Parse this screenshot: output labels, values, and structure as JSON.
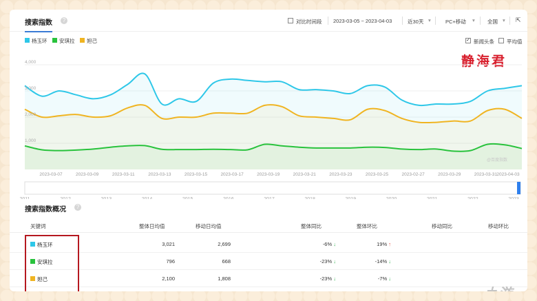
{
  "header": {
    "title": "搜索指数",
    "compare_label": "对比时间段",
    "date_range": "2023-03-05 ~ 2023-04-03",
    "period": "近30天",
    "device": "PC+移动",
    "region": "全国"
  },
  "legend": [
    {
      "name": "杨玉环",
      "color": "#2ec7e8"
    },
    {
      "name": "安琪拉",
      "color": "#28c23c"
    },
    {
      "name": "妲己",
      "color": "#f0b421"
    }
  ],
  "options": {
    "news_label": "新闻头条",
    "avg_label": "平均值",
    "news_checked": true,
    "avg_checked": false
  },
  "watermark": "静海君",
  "chart_credit": "@百度指数",
  "chart_data": {
    "type": "line",
    "x": [
      "2023-03-05",
      "2023-03-06",
      "2023-03-07",
      "2023-03-08",
      "2023-03-09",
      "2023-03-10",
      "2023-03-11",
      "2023-03-12",
      "2023-03-13",
      "2023-03-14",
      "2023-03-15",
      "2023-03-16",
      "2023-03-17",
      "2023-03-18",
      "2023-03-19",
      "2023-03-20",
      "2023-03-21",
      "2023-03-22",
      "2023-03-23",
      "2023-03-24",
      "2023-03-25",
      "2023-03-26",
      "2023-03-27",
      "2023-03-28",
      "2023-03-29",
      "2023-03-30",
      "2023-03-31",
      "2023-04-01",
      "2023-04-02",
      "2023-04-03"
    ],
    "tick_labels": [
      "2023-03-07",
      "2023-03-09",
      "2023-03-11",
      "2023-03-13",
      "2023-03-15",
      "2023-03-17",
      "2023-03-19",
      "2023-03-21",
      "2023-03-23",
      "2023-03-25",
      "2023-02-27",
      "2023-03-29",
      "2023-03-31",
      "2023-04-03"
    ],
    "y_ticks": [
      "4,000",
      "3,000",
      "2,000",
      "1,000"
    ],
    "ylim": [
      0,
      4000
    ],
    "grid": true,
    "series": [
      {
        "name": "杨玉环",
        "color": "#2ec7e8",
        "values": [
          3200,
          2800,
          3000,
          2850,
          2700,
          2850,
          3250,
          3650,
          2500,
          2700,
          2600,
          3300,
          3450,
          3400,
          3350,
          3350,
          3050,
          3050,
          3000,
          2900,
          3200,
          3150,
          2650,
          2450,
          2500,
          2500,
          2600,
          3000,
          3100,
          3200
        ]
      },
      {
        "name": "安琪拉",
        "color": "#28c23c",
        "values": [
          900,
          750,
          720,
          740,
          780,
          850,
          900,
          910,
          770,
          760,
          760,
          770,
          760,
          750,
          960,
          900,
          850,
          820,
          820,
          820,
          850,
          840,
          780,
          760,
          780,
          700,
          720,
          960,
          940,
          800
        ]
      },
      {
        "name": "妲己",
        "color": "#f0b421",
        "values": [
          2300,
          2000,
          2050,
          2100,
          2000,
          2050,
          2350,
          2450,
          1950,
          2000,
          2000,
          2150,
          2150,
          2150,
          2450,
          2400,
          2050,
          2000,
          1950,
          1900,
          2300,
          2250,
          1950,
          1800,
          1800,
          1850,
          1850,
          2250,
          2300,
          1950
        ]
      }
    ],
    "range_years": [
      "2011",
      "2012",
      "2013",
      "2014",
      "2015",
      "2016",
      "2017",
      "2018",
      "2019",
      "2020",
      "2021",
      "2022",
      "2023"
    ]
  },
  "overview": {
    "title": "搜索指数概况",
    "columns": [
      "关键词",
      "整体日均值",
      "移动日均值",
      "整体同比",
      "整体环比",
      "移动同比",
      "移动环比"
    ],
    "rows": [
      {
        "keyword": "杨玉环",
        "color": "#2ec7e8",
        "overall_avg": "3,021",
        "mobile_avg": "2,699",
        "yoy": "-6%",
        "yoy_dir": "down",
        "mom": "19%",
        "mom_dir": "up"
      },
      {
        "keyword": "安琪拉",
        "color": "#28c23c",
        "overall_avg": "796",
        "mobile_avg": "668",
        "yoy": "-23%",
        "yoy_dir": "down",
        "mom": "-14%",
        "mom_dir": "down"
      },
      {
        "keyword": "妲己",
        "color": "#f0b421",
        "overall_avg": "2,100",
        "mobile_avg": "1,808",
        "yoy": "-23%",
        "yoy_dir": "down",
        "mom": "-7%",
        "mom_dir": "down"
      }
    ]
  },
  "site_logo": "九游"
}
